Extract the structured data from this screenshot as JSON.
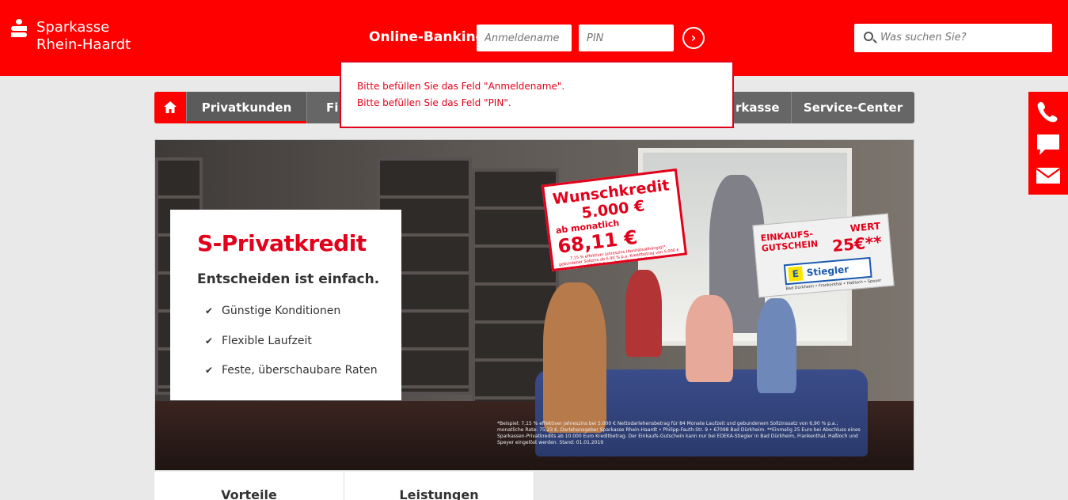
{
  "header": {
    "brand_line1": "Sparkasse",
    "brand_line2": "Rhein-Haardt",
    "online_banking_label": "Online-Banking",
    "username_placeholder": "Anmeldename",
    "pin_placeholder": "PIN",
    "search_placeholder": "Was suchen Sie?"
  },
  "nav": {
    "items": [
      {
        "label": "Privatkunden"
      },
      {
        "label": "Fi"
      },
      {
        "label": "rkasse"
      },
      {
        "label": "Service-Center"
      }
    ]
  },
  "error": {
    "line1": "Bitte befüllen Sie das Feld \"Anmeldename\".",
    "line2": "Bitte befüllen Sie das Feld \"PIN\"."
  },
  "teaser": {
    "title": "S-Privatkredit",
    "subtitle": "Entscheiden ist einfach.",
    "bullets": [
      "Günstige Konditionen",
      "Flexible Laufzeit",
      "Feste, überschaubare Raten"
    ]
  },
  "promo": {
    "line1": "Wunschkredit",
    "line2": "5.000 €",
    "rate_prefix": "ab monatlich",
    "rate": "68,11 €",
    "small": "7,15 % effektiver Jahreszins (bonitätsabhängig)*, gebundener Sollzins ab 6,90 % p.a. Kreditbetrag von 5.000 € bis 50.000 €, Laufzeit 12 bis 84 Monate"
  },
  "voucher": {
    "title": "EINKAUFS-GUTSCHEIN",
    "value_label": "WERT",
    "value": "25€**",
    "store": "Stiegler",
    "cities": "Bad Dürkheim • Frankenthal • Haßloch • Speyer"
  },
  "fineprint": "*Beispiel: 7,15 % effektiver Jahreszins bei 5.000 € Nettodarlehensbetrag für 84 Monate Laufzeit und gebundenem Sollzinssatz von 6,90 % p.a.; monatliche Rate: 75,23 €. Darlehensgeber Sparkasse Rhein-Haardt • Philipp-Fauth-Str. 9 • 67098 Bad Dürkheim. **Einmalig 25 Euro bei Abschluss eines Sparkassen-Privatkredits ab 10.000 Euro Kreditbetrag. Der Einkaufs-Gutschein kann nur bei EDEKA-Stiegler in Bad Dürkheim, Frankenthal, Haßloch und Speyer eingelöst werden. Stand: 01.01.2019",
  "tabs": [
    {
      "label": "Vorteile"
    },
    {
      "label": "Leistungen"
    }
  ],
  "side_icons": [
    "phone-icon",
    "chat-icon",
    "mail-icon"
  ],
  "colors": {
    "brand_red": "#ff0000",
    "nav_gray": "#666666"
  }
}
